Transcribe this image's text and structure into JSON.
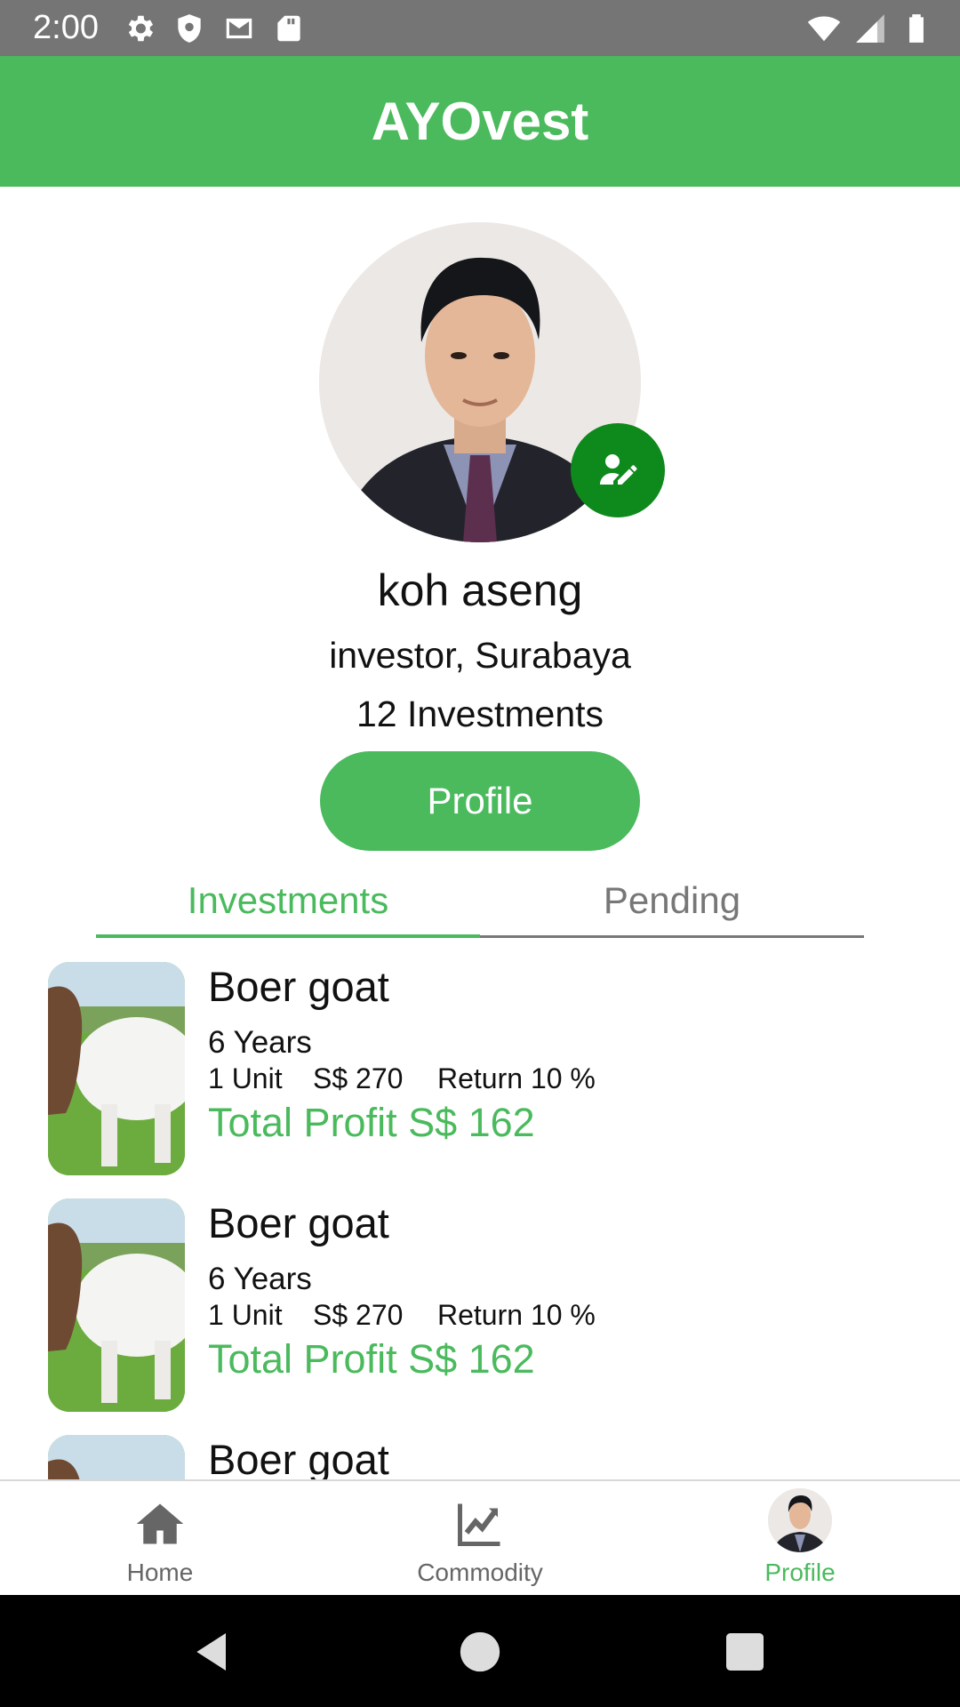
{
  "status_bar": {
    "time": "2:00",
    "left_icons": [
      "settings-icon",
      "shield-icon",
      "mail-icon",
      "sd-card-icon"
    ],
    "right_icons": [
      "wifi-icon",
      "signal-icon",
      "battery-icon"
    ]
  },
  "app_bar": {
    "title": "AYOvest"
  },
  "profile": {
    "name": "koh aseng",
    "role": "investor, Surabaya",
    "investments_count": "12 Investments",
    "button_label": "Profile",
    "edit_icon": "edit-user-icon"
  },
  "tabs": [
    {
      "label": "Investments",
      "active": true
    },
    {
      "label": "Pending",
      "active": false
    }
  ],
  "investments": [
    {
      "title": "Boer goat",
      "duration": "6 Years",
      "units": "1 Unit",
      "price": "S$ 270",
      "return": "Return 10 %",
      "profit": "Total Profit S$ 162"
    },
    {
      "title": "Boer goat",
      "duration": "6 Years",
      "units": "1 Unit",
      "price": "S$ 270",
      "return": "Return 10 %",
      "profit": "Total Profit S$ 162"
    },
    {
      "title": "Boer goat"
    }
  ],
  "bottom_nav": [
    {
      "label": "Home",
      "icon": "home-icon",
      "active": false
    },
    {
      "label": "Commodity",
      "icon": "chart-line-icon",
      "active": false
    },
    {
      "label": "Profile",
      "icon": "avatar",
      "active": true
    }
  ],
  "colors": {
    "primary": "#4aba5d",
    "edit_fab": "#0e8a1c",
    "status_bar": "#757575",
    "inactive_tab": "#777777"
  }
}
